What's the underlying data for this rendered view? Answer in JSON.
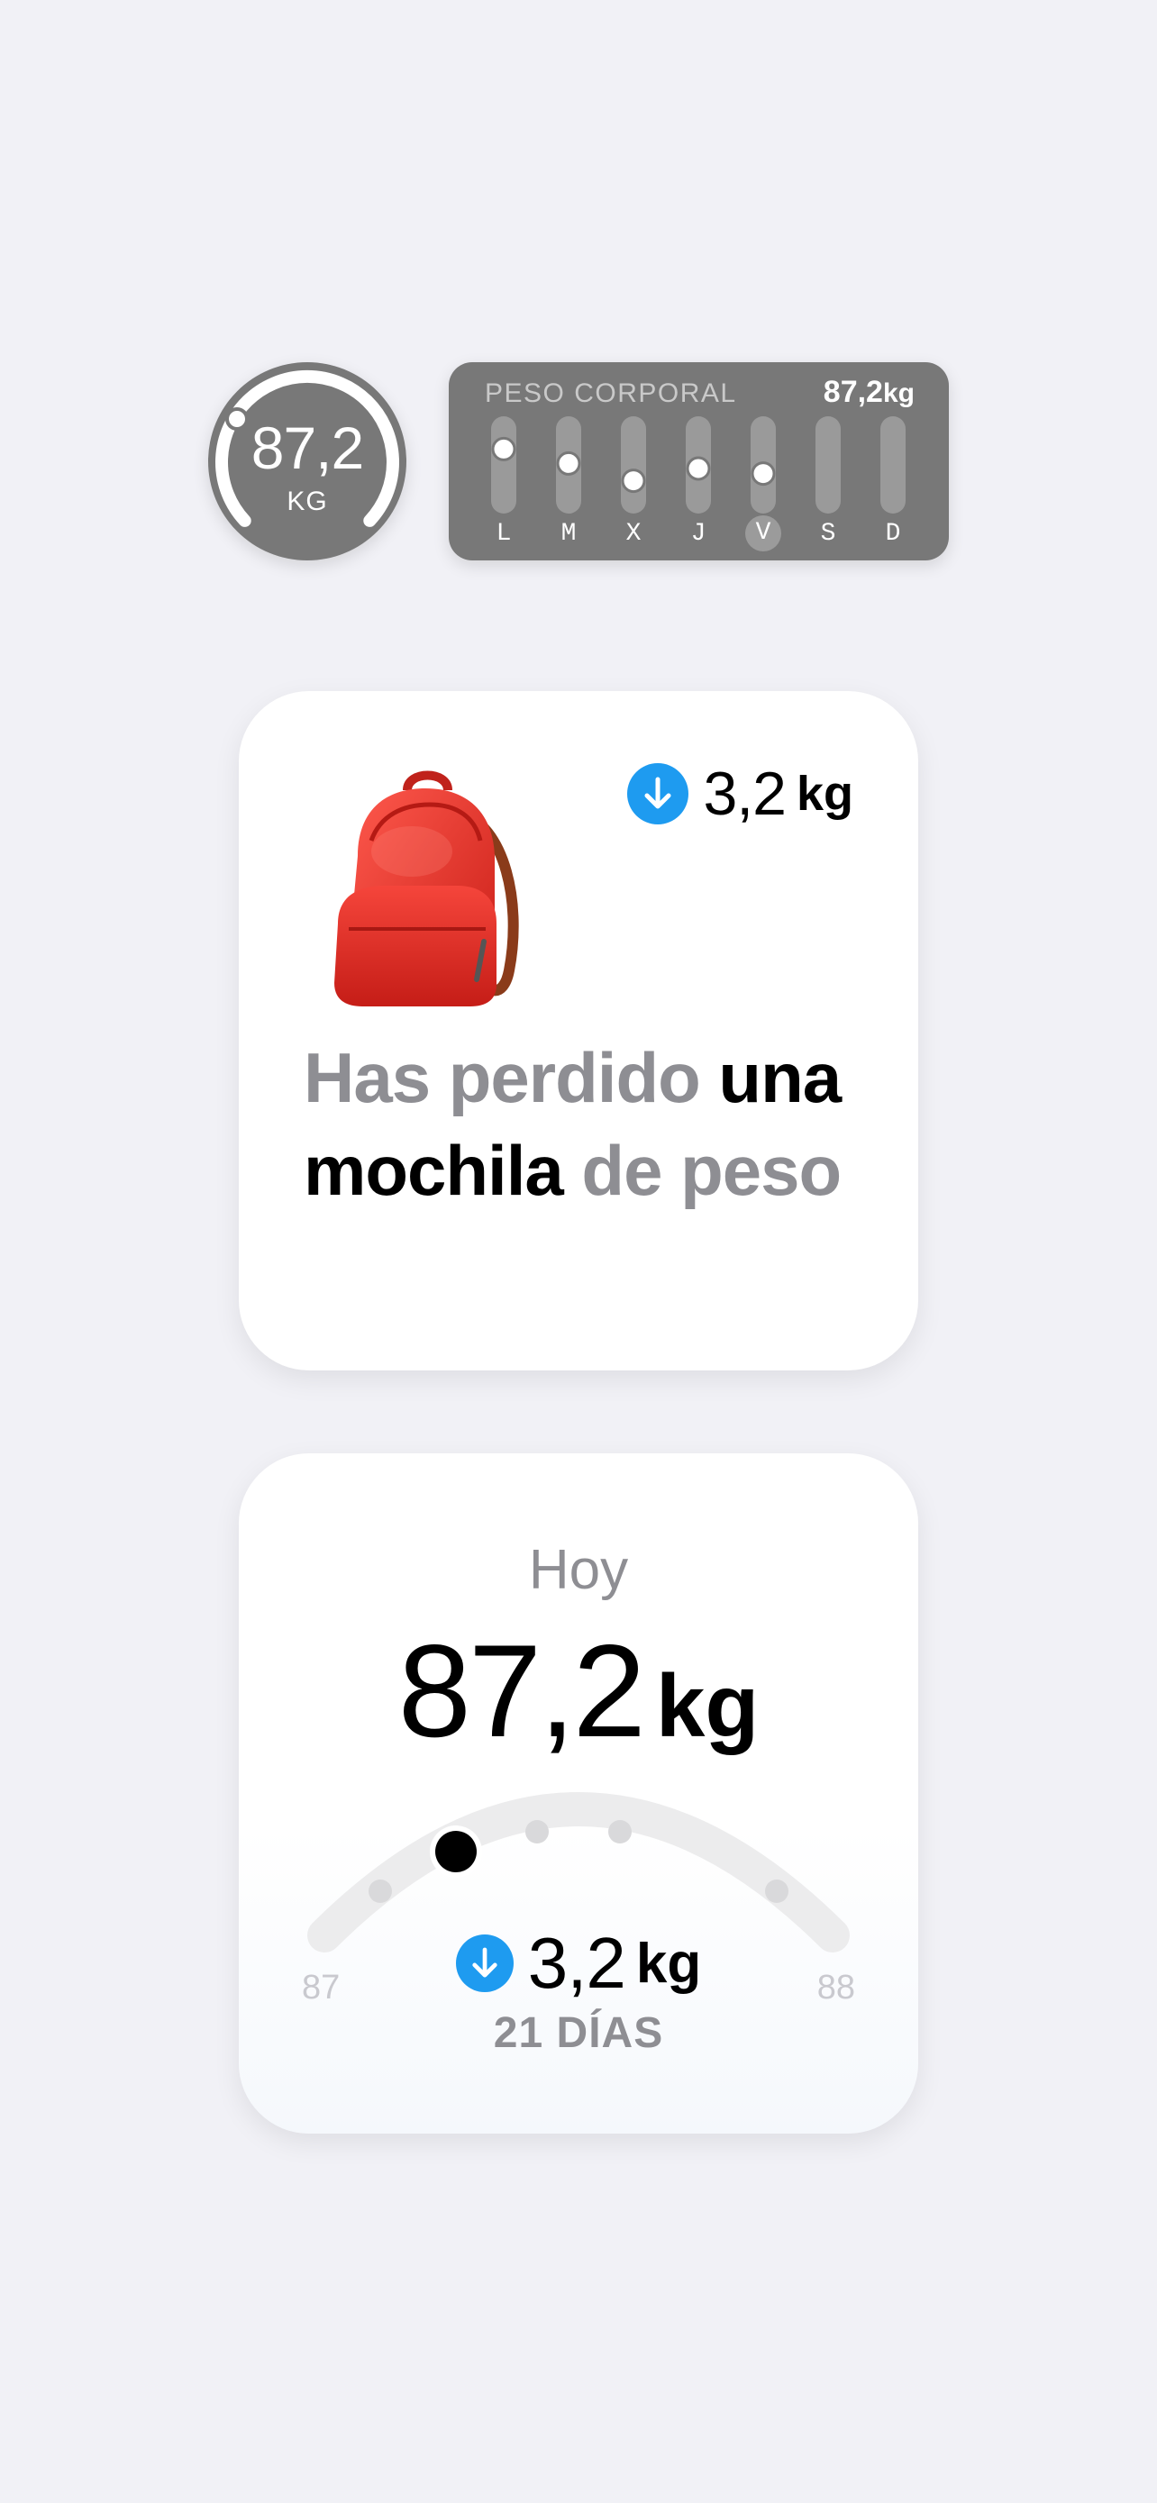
{
  "circle_widget": {
    "value": "87,2",
    "unit": "KG",
    "progress": 0.97
  },
  "week_widget": {
    "title": "PESO CORPORAL",
    "value": "87,2",
    "unit": "kg",
    "days": [
      "L",
      "M",
      "X",
      "J",
      "V",
      "S",
      "D"
    ],
    "selected_day": "V",
    "day_levels": [
      0.72,
      0.52,
      0.28,
      0.45,
      0.38,
      null,
      null
    ]
  },
  "backpack_card": {
    "delta_value": "3,2",
    "delta_unit": "kg",
    "headline_part1": "Has perdido ",
    "headline_strong": "una mochila",
    "headline_part2": " de peso"
  },
  "today_card": {
    "label": "Hoy",
    "value": "87,2",
    "unit": "kg",
    "range_min": "87",
    "range_max": "88",
    "delta_value": "3,2",
    "delta_unit": "kg",
    "days_label": "21 DÍAS",
    "current_position": 0.27
  },
  "colors": {
    "background": "#f1f1f6",
    "widget_gray": "#787878",
    "accent_blue": "#1e9bf0",
    "secondary_text": "#8e8e93"
  }
}
